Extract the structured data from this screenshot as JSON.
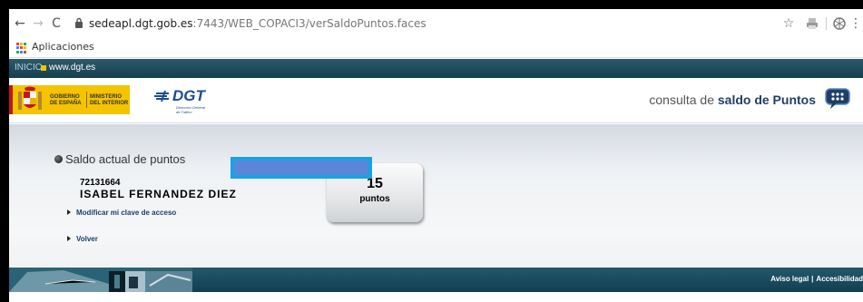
{
  "browser": {
    "url_host": "sedeapl.dgt.gob.es",
    "url_rest": ":7443/WEB_COPACI3/verSaldoPuntos.faces",
    "bookmarks_label": "Aplicaciones"
  },
  "site": {
    "inicio_link": "INICIO",
    "web_link": "www.dgt.es",
    "gov_line1": "GOBIERNO",
    "gov_line2": "DE ESPAÑA",
    "ministry_line1": "MINISTERIO",
    "ministry_line2": "DEL INTERIOR",
    "dgt_logo_text": "DGT",
    "dgt_sub1": "Dirección General",
    "dgt_sub2": "de Tráfico",
    "service_prefix": "consulta de ",
    "service_name": "saldo de Puntos"
  },
  "main": {
    "section_title": "Saldo actual de puntos",
    "user_id": "72131664",
    "user_name": "ISABEL FERNANDEZ DIEZ",
    "points_value": "15",
    "points_unit": "puntos",
    "link_change_key": "Modificar mi clave de acceso",
    "link_back": "Volver"
  },
  "footer": {
    "legal": "Aviso legal",
    "separator": "|",
    "accessibility": "Accesibilidad"
  },
  "colors": {
    "header_bar": "#163f4f",
    "accent_yellow": "#f5c300",
    "redaction": "#5b86d6",
    "redaction_border": "#16a3e6"
  }
}
